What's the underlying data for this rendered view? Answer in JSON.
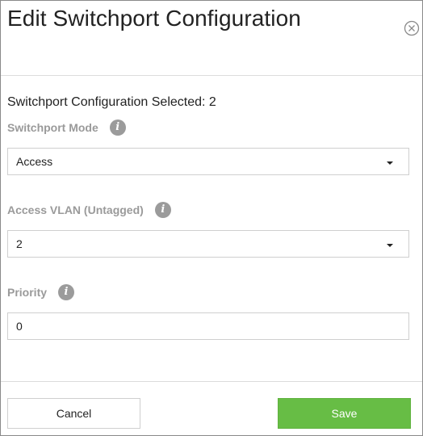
{
  "dialog": {
    "title": "Edit Switchport Configuration",
    "close_icon": "close-circle-icon"
  },
  "form": {
    "selected_text": "Switchport Configuration Selected: 2",
    "switchport_mode": {
      "label": "Switchport Mode",
      "value": "Access",
      "info_icon": "info-icon"
    },
    "access_vlan": {
      "label": "Access VLAN (Untagged)",
      "value": "2",
      "info_icon": "info-icon"
    },
    "priority": {
      "label": "Priority",
      "value": "0",
      "info_icon": "info-icon"
    }
  },
  "footer": {
    "cancel_label": "Cancel",
    "save_label": "Save"
  },
  "colors": {
    "save_button": "#67bd45",
    "label_gray": "#9a9a9a"
  }
}
